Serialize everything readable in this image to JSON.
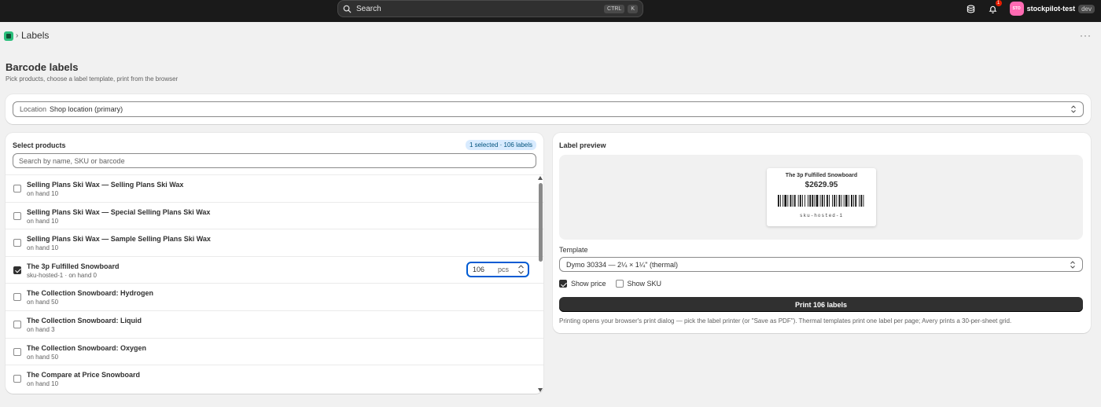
{
  "topbar": {
    "search_placeholder": "Search",
    "shortcut_ctrl": "CTRL",
    "shortcut_k": "K",
    "notification_count": "1",
    "avatar_initials": "STO",
    "store_name": "stockpilot-test",
    "store_badge": "dev"
  },
  "titlebar": {
    "breadcrumb": "Labels",
    "more": "···"
  },
  "header": {
    "title": "Barcode labels",
    "subtitle": "Pick products, choose a label template, print from the browser"
  },
  "location": {
    "label": "Location",
    "value": "Shop location (primary)"
  },
  "products": {
    "heading": "Select products",
    "badge": "1 selected · 106 labels",
    "search_placeholder": "Search by name, SKU or barcode",
    "items": [
      {
        "title": "Selling Plans Ski Wax — Selling Plans Ski Wax",
        "sub": "on hand 10",
        "checked": false
      },
      {
        "title": "Selling Plans Ski Wax — Special Selling Plans Ski Wax",
        "sub": "on hand 10",
        "checked": false
      },
      {
        "title": "Selling Plans Ski Wax — Sample Selling Plans Ski Wax",
        "sub": "on hand 10",
        "checked": false
      },
      {
        "title": "The 3p Fulfilled Snowboard",
        "sub": "sku-hosted-1 · on hand 0",
        "checked": true,
        "qty": "106",
        "unit": "pcs"
      },
      {
        "title": "The Collection Snowboard: Hydrogen",
        "sub": "on hand 50",
        "checked": false
      },
      {
        "title": "The Collection Snowboard: Liquid",
        "sub": "on hand 3",
        "checked": false
      },
      {
        "title": "The Collection Snowboard: Oxygen",
        "sub": "on hand 50",
        "checked": false
      },
      {
        "title": "The Compare at Price Snowboard",
        "sub": "on hand 10",
        "checked": false
      }
    ]
  },
  "preview": {
    "heading": "Label preview",
    "label_title": "The 3p Fulfilled Snowboard",
    "label_price": "$2629.95",
    "label_sku": "sku-hosted-1",
    "template_label": "Template",
    "template_value": "Dymo 30334 — 2¼ × 1¼\" (thermal)",
    "show_price_label": "Show price",
    "show_price": true,
    "show_sku_label": "Show SKU",
    "show_sku": false,
    "print_button": "Print 106 labels",
    "help_text": "Printing opens your browser's print dialog — pick the label printer (or \"Save as PDF\"). Thermal templates print one label per page; Avery prints a 30-per-sheet grid."
  },
  "colors": {
    "topbar_bg": "#1a1a1a",
    "accent": "#005bd3",
    "badge_bg": "#d8ebff",
    "primary_button": "#303030",
    "avatar_bg": "#ff6bb3",
    "app_icon": "#2bbf7c"
  }
}
